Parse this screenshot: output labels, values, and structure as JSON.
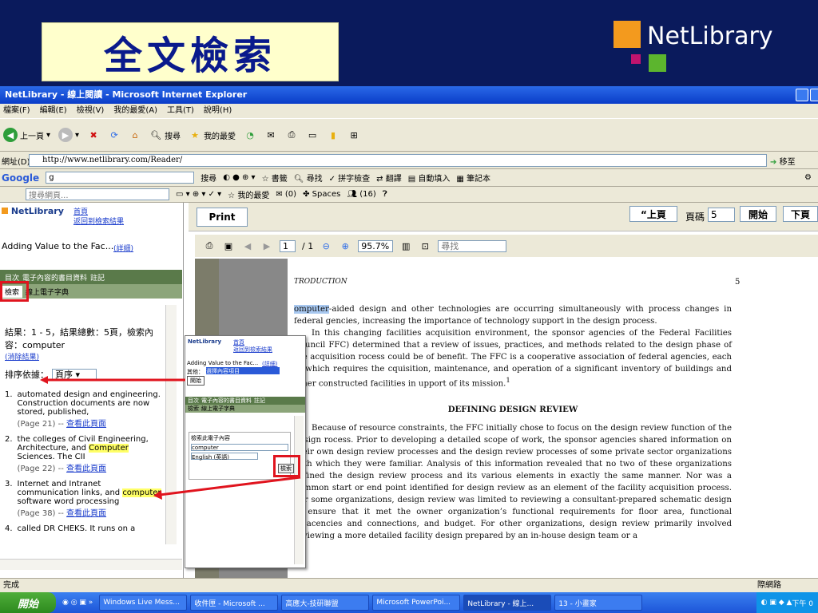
{
  "slide": {
    "title": "全文檢索",
    "logo_text": "NetLibrary"
  },
  "window": {
    "title": "NetLibrary - 線上閱讀 - Microsoft Internet Explorer"
  },
  "menu": [
    "檔案(F)",
    "編輯(E)",
    "檢視(V)",
    "我的最愛(A)",
    "工具(T)",
    "說明(H)"
  ],
  "toolbar": {
    "back": "上一頁",
    "search": "搜尋",
    "favorites": "我的最愛"
  },
  "address": {
    "label": "網址(D)",
    "url": "http://www.netlibrary.com/Reader/",
    "go": "移至"
  },
  "google": {
    "brand": "Google",
    "input": "g",
    "search": "搜尋",
    "bookmarks": "書籤",
    "find": "尋找",
    "spell": "拼字檢查",
    "translate": "翻譯",
    "autofill": "自動填入",
    "notebook": "筆記本"
  },
  "favbar": {
    "search_placeholder": "搜尋網頁...",
    "favorites": "我的最愛",
    "mail": "(0)",
    "spaces": "Spaces",
    "count": "(16)"
  },
  "left": {
    "logo": "NetLibrary",
    "back_link": "首頁",
    "back_link2": "返回到檢索結果",
    "book_title": "Adding Value to the Fac...",
    "detail": "(詳細)",
    "tabs": [
      "目次",
      "電子內容的書目資料",
      "註記"
    ],
    "tabs2": [
      "檢索",
      "線上電子字典"
    ],
    "result_summary": "結果：1 - 5，結果總數：5頁，檢索內容：computer",
    "clear": "(消除結果)",
    "sort_label": "排序依據：",
    "sort_value": "頁序",
    "results": [
      {
        "num": "1.",
        "pre": "automated design and engineering. Construction documents are now stored, published,",
        "hl": "",
        "post": "",
        "page": "(Page 21) --",
        "link": "查看此頁面"
      },
      {
        "num": "2.",
        "pre": "the colleges of Civil Engineering, Architecture, and ",
        "hl": "Computer",
        "post": " Sciences. The CII",
        "page": "(Page 22) --",
        "link": "查看此頁面"
      },
      {
        "num": "3.",
        "pre": "Internet and Intranet communication links, and ",
        "hl": "computer",
        "post": " software word processing",
        "page": "(Page 38) --",
        "link": "查看此頁面"
      },
      {
        "num": "4.",
        "pre": "called DR CHEKS. It runs on a",
        "hl": "",
        "post": "",
        "page": "",
        "link": ""
      }
    ]
  },
  "reader": {
    "print": "Print",
    "prev": "“上頁",
    "page_label": "頁碼",
    "page_value": "5",
    "go": "開始",
    "next": "下頁",
    "page_num": "1",
    "page_total": "/ 1",
    "zoom": "95.7%",
    "find_placeholder": "尋找"
  },
  "popup": {
    "logo": "NetLibrary",
    "link1": "首頁",
    "link2": "返回到檢索結果",
    "title": "Adding Value to the Fac...",
    "detail": "(詳細)",
    "other": "其他：",
    "other_select": "選擇內容項目",
    "go": "開始",
    "tabs": [
      "目次",
      "電子內容的書目資料",
      "註記"
    ],
    "tabs2": [
      "檢索",
      "線上電子字典"
    ],
    "search_label": "檢索此電子內容",
    "search_value": "computer",
    "lang": "English (英語)",
    "search_btn": "檢索"
  },
  "doc": {
    "header_left": "TRODUCTION",
    "header_right": "5",
    "p1_hl": "omputer",
    "p1": "-aided design and other technologies are occurring simultaneously with process changes in federal gencies, increasing the importance of technology support in the design process.",
    "p2": "In this changing facilities acquisition environment, the sponsor agencies of the Federal Facilities Council FFC) determined that a review of issues, practices, and methods related to the design phase of the acquisition rocess could be of benefit. The FFC is a cooperative association of federal agencies, each of which requires the cquisition, maintenance, and operation of a significant inventory of buildings and other constructed facilities in upport of its mission.",
    "footnote": "1",
    "heading": "DEFINING DESIGN REVIEW",
    "p3": "Because of resource constraints, the FFC initially chose to focus on the design review function of the design rocess. Prior to developing a detailed scope of work, the sponsor agencies shared information on their own design review processes and the design review processes of some private sector organizations with which they were familiar. Analysis of this information revealed that no two of these organizations defined the design review process and its various elements in exactly the same manner. Nor was a common start or end point identified for design review as an element of the facility acquisition process. For some organizations, design review was limited to reviewing a consultant-prepared schematic design to ensure that it met the owner organization’s functional requirements for floor area, functional adjacencies and connections, and budget. For other organizations, design review primarily involved reviewing a more detailed facility design prepared by an in-house design team or a"
  },
  "status": {
    "text": "完成",
    "zone": "際網路"
  },
  "taskbar": {
    "start": "開始",
    "items": [
      "Windows Live Mess...",
      "收件匣 - Microsoft ...",
      "高應大-技研聯盟",
      "Microsoft PowerPoi...",
      "NetLibrary - 線上...",
      "13 - 小畫家"
    ],
    "clock": "下午 0"
  }
}
